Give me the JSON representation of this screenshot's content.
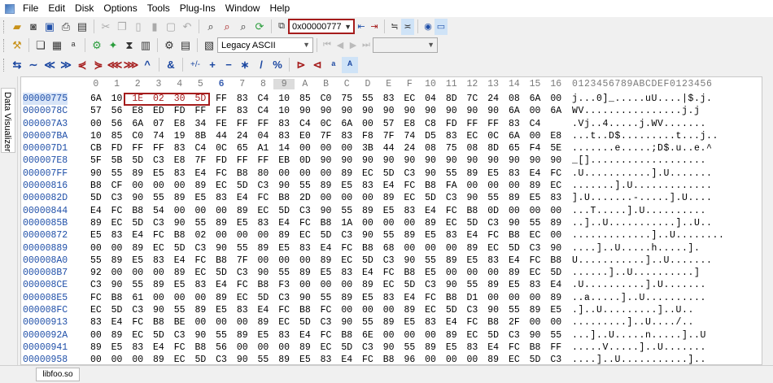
{
  "menu": [
    "File",
    "Edit",
    "Disk",
    "Options",
    "Tools",
    "Plug-Ins",
    "Window",
    "Help"
  ],
  "toolbar": {
    "address_value": "0x00000777",
    "encoding_value": "Legacy ASCII"
  },
  "toolbar3_labels": [
    "+/-"
  ],
  "side_panel": {
    "tab_label": "Data Visualizer"
  },
  "hex": {
    "column_headers": [
      "0",
      "1",
      "2",
      "3",
      "4",
      "5",
      "6",
      "7",
      "8",
      "9",
      "A",
      "B",
      "C",
      "D",
      "E",
      "F",
      "10",
      "11",
      "12",
      "13",
      "14",
      "15",
      "16"
    ],
    "ascii_header": "0123456789ABCDEF0123456",
    "rows": [
      {
        "offset": "00000775",
        "bytes": [
          "6A",
          "10",
          "1E",
          "02",
          "30",
          "5D",
          "FF",
          "83",
          "C4",
          "10",
          "85",
          "C0",
          "75",
          "55",
          "83",
          "EC",
          "04",
          "8D",
          "7C",
          "24",
          "08",
          "6A",
          "00"
        ],
        "ascii": "j...0]_.....uU....|$.j."
      },
      {
        "offset": "0000078C",
        "bytes": [
          "57",
          "56",
          "E8",
          "ED",
          "FD",
          "FF",
          "FF",
          "83",
          "C4",
          "10",
          "90",
          "90",
          "90",
          "90",
          "90",
          "90",
          "90",
          "90",
          "90",
          "90",
          "6A",
          "00",
          "6A"
        ],
        "ascii": "WV................j.j"
      },
      {
        "offset": "000007A3",
        "bytes": [
          "00",
          "56",
          "6A",
          "07",
          "E8",
          "34",
          "FE",
          "FF",
          "FF",
          "83",
          "C4",
          "0C",
          "6A",
          "00",
          "57",
          "E8",
          "C8",
          "FD",
          "FF",
          "FF",
          "83",
          "C4"
        ],
        "ascii": ".Vj..4.....j.WV......."
      },
      {
        "offset": "000007BA",
        "bytes": [
          "10",
          "85",
          "C0",
          "74",
          "19",
          "8B",
          "44",
          "24",
          "04",
          "83",
          "E0",
          "7F",
          "83",
          "F8",
          "7F",
          "74",
          "D5",
          "83",
          "EC",
          "0C",
          "6A",
          "00",
          "E8"
        ],
        "ascii": "...t..D$.........t...j.."
      },
      {
        "offset": "000007D1",
        "bytes": [
          "CB",
          "FD",
          "FF",
          "FF",
          "83",
          "C4",
          "0C",
          "65",
          "A1",
          "14",
          "00",
          "00",
          "00",
          "3B",
          "44",
          "24",
          "08",
          "75",
          "08",
          "8D",
          "65",
          "F4",
          "5E"
        ],
        "ascii": ".......e.....;D$.u..e.^"
      },
      {
        "offset": "000007E8",
        "bytes": [
          "5F",
          "5B",
          "5D",
          "C3",
          "E8",
          "7F",
          "FD",
          "FF",
          "FF",
          "EB",
          "0D",
          "90",
          "90",
          "90",
          "90",
          "90",
          "90",
          "90",
          "90",
          "90",
          "90",
          "90",
          "90"
        ],
        "ascii": "_[]..................."
      },
      {
        "offset": "000007FF",
        "bytes": [
          "90",
          "55",
          "89",
          "E5",
          "83",
          "E4",
          "FC",
          "B8",
          "80",
          "00",
          "00",
          "00",
          "89",
          "EC",
          "5D",
          "C3",
          "90",
          "55",
          "89",
          "E5",
          "83",
          "E4",
          "FC"
        ],
        "ascii": ".U...........].U......."
      },
      {
        "offset": "00000816",
        "bytes": [
          "B8",
          "CF",
          "00",
          "00",
          "00",
          "89",
          "EC",
          "5D",
          "C3",
          "90",
          "55",
          "89",
          "E5",
          "83",
          "E4",
          "FC",
          "B8",
          "FA",
          "00",
          "00",
          "00",
          "89",
          "EC"
        ],
        "ascii": ".......].U............."
      },
      {
        "offset": "0000082D",
        "bytes": [
          "5D",
          "C3",
          "90",
          "55",
          "89",
          "E5",
          "83",
          "E4",
          "FC",
          "B8",
          "2D",
          "00",
          "00",
          "00",
          "89",
          "EC",
          "5D",
          "C3",
          "90",
          "55",
          "89",
          "E5",
          "83"
        ],
        "ascii": "].U.......-.....].U...."
      },
      {
        "offset": "00000844",
        "bytes": [
          "E4",
          "FC",
          "B8",
          "54",
          "00",
          "00",
          "00",
          "89",
          "EC",
          "5D",
          "C3",
          "90",
          "55",
          "89",
          "E5",
          "83",
          "E4",
          "FC",
          "B8",
          "0D",
          "00",
          "00",
          "00"
        ],
        "ascii": "...T.....].U.........."
      },
      {
        "offset": "0000085B",
        "bytes": [
          "89",
          "EC",
          "5D",
          "C3",
          "90",
          "55",
          "89",
          "E5",
          "83",
          "E4",
          "FC",
          "B8",
          "1A",
          "00",
          "00",
          "00",
          "89",
          "EC",
          "5D",
          "C3",
          "90",
          "55",
          "89"
        ],
        "ascii": "..]..U...........]..U.."
      },
      {
        "offset": "00000872",
        "bytes": [
          "E5",
          "83",
          "E4",
          "FC",
          "B8",
          "02",
          "00",
          "00",
          "00",
          "89",
          "EC",
          "5D",
          "C3",
          "90",
          "55",
          "89",
          "E5",
          "83",
          "E4",
          "FC",
          "B8",
          "EC",
          "00"
        ],
        "ascii": ".............]..U........"
      },
      {
        "offset": "00000889",
        "00": "",
        "bytes": [
          "00",
          "00",
          "89",
          "EC",
          "5D",
          "C3",
          "90",
          "55",
          "89",
          "E5",
          "83",
          "E4",
          "FC",
          "B8",
          "68",
          "00",
          "00",
          "00",
          "89",
          "EC",
          "5D",
          "C3",
          "90"
        ],
        "ascii": "....]..U.....h.....]."
      },
      {
        "offset": "000008A0",
        "bytes": [
          "55",
          "89",
          "E5",
          "83",
          "E4",
          "FC",
          "B8",
          "7F",
          "00",
          "00",
          "00",
          "89",
          "EC",
          "5D",
          "C3",
          "90",
          "55",
          "89",
          "E5",
          "83",
          "E4",
          "FC",
          "B8"
        ],
        "ascii": "U...........]..U......."
      },
      {
        "offset": "000008B7",
        "bytes": [
          "92",
          "00",
          "00",
          "00",
          "89",
          "EC",
          "5D",
          "C3",
          "90",
          "55",
          "89",
          "E5",
          "83",
          "E4",
          "FC",
          "B8",
          "E5",
          "00",
          "00",
          "00",
          "89",
          "EC",
          "5D"
        ],
        "ascii": "......]..U..........]"
      },
      {
        "offset": "000008CE",
        "bytes": [
          "C3",
          "90",
          "55",
          "89",
          "E5",
          "83",
          "E4",
          "FC",
          "B8",
          "F3",
          "00",
          "00",
          "00",
          "89",
          "EC",
          "5D",
          "C3",
          "90",
          "55",
          "89",
          "E5",
          "83",
          "E4"
        ],
        "ascii": ".U..........].U......."
      },
      {
        "offset": "000008E5",
        "bytes": [
          "FC",
          "B8",
          "61",
          "00",
          "00",
          "00",
          "89",
          "EC",
          "5D",
          "C3",
          "90",
          "55",
          "89",
          "E5",
          "83",
          "E4",
          "FC",
          "B8",
          "D1",
          "00",
          "00",
          "00",
          "89"
        ],
        "ascii": "..a.....]..U.........."
      },
      {
        "offset": "000008FC",
        "bytes": [
          "EC",
          "5D",
          "C3",
          "90",
          "55",
          "89",
          "E5",
          "83",
          "E4",
          "FC",
          "B8",
          "FC",
          "00",
          "00",
          "00",
          "89",
          "EC",
          "5D",
          "C3",
          "90",
          "55",
          "89",
          "E5"
        ],
        "ascii": ".]..U.........]..U.."
      },
      {
        "offset": "00000913",
        "bytes": [
          "83",
          "E4",
          "FC",
          "B8",
          "BE",
          "00",
          "00",
          "00",
          "89",
          "EC",
          "5D",
          "C3",
          "90",
          "55",
          "89",
          "E5",
          "83",
          "E4",
          "FC",
          "B8",
          "2F",
          "00",
          "00"
        ],
        "ascii": ".........]..U..../.."
      },
      {
        "offset": "0000092A",
        "bytes": [
          "00",
          "89",
          "EC",
          "5D",
          "C3",
          "90",
          "55",
          "89",
          "E5",
          "83",
          "E4",
          "FC",
          "B8",
          "6E",
          "00",
          "00",
          "00",
          "89",
          "EC",
          "5D",
          "C3",
          "90",
          "55"
        ],
        "ascii": "...]..U.....n.....]..U"
      },
      {
        "offset": "00000941",
        "bytes": [
          "89",
          "E5",
          "83",
          "E4",
          "FC",
          "B8",
          "56",
          "00",
          "00",
          "00",
          "89",
          "EC",
          "5D",
          "C3",
          "90",
          "55",
          "89",
          "E5",
          "83",
          "E4",
          "FC",
          "B8",
          "FF"
        ],
        "ascii": ".....V.....]..U......."
      },
      {
        "offset": "00000958",
        "bytes": [
          "00",
          "00",
          "00",
          "89",
          "EC",
          "5D",
          "C3",
          "90",
          "55",
          "89",
          "E5",
          "83",
          "E4",
          "FC",
          "B8",
          "96",
          "00",
          "00",
          "00",
          "89",
          "EC",
          "5D",
          "C3"
        ],
        "ascii": "....]..U...........].."
      }
    ]
  },
  "file_tab": "libfoo.so"
}
